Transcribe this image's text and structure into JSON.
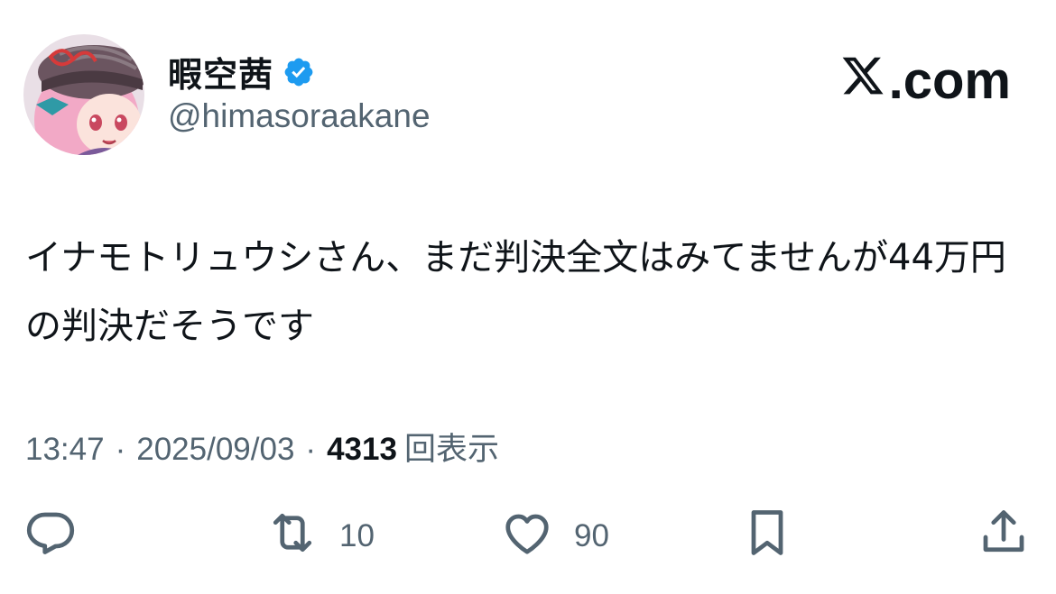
{
  "author": {
    "display_name": "暇空茜",
    "handle": "@himasoraakane",
    "verified_icon": "verified-badge-icon",
    "avatar": "anime-character-avatar"
  },
  "brand": {
    "label": ".com",
    "logo_icon": "x-logo-icon"
  },
  "tweet": {
    "text": "イナモトリュウシさん、まだ判決全文はみてませんが44万円の判決だそうです"
  },
  "meta": {
    "time": "13:47",
    "separator": "·",
    "date": "2025/09/03",
    "views_count": "4313",
    "views_label": "回表示"
  },
  "actions": {
    "reply": {
      "icon": "reply-icon"
    },
    "retweet": {
      "icon": "retweet-icon",
      "count": "10"
    },
    "like": {
      "icon": "heart-icon",
      "count": "90"
    },
    "bookmark": {
      "icon": "bookmark-icon"
    },
    "share": {
      "icon": "share-icon"
    }
  },
  "colors": {
    "text": "#0f1419",
    "secondary": "#536471",
    "verified": "#1d9bf0"
  }
}
